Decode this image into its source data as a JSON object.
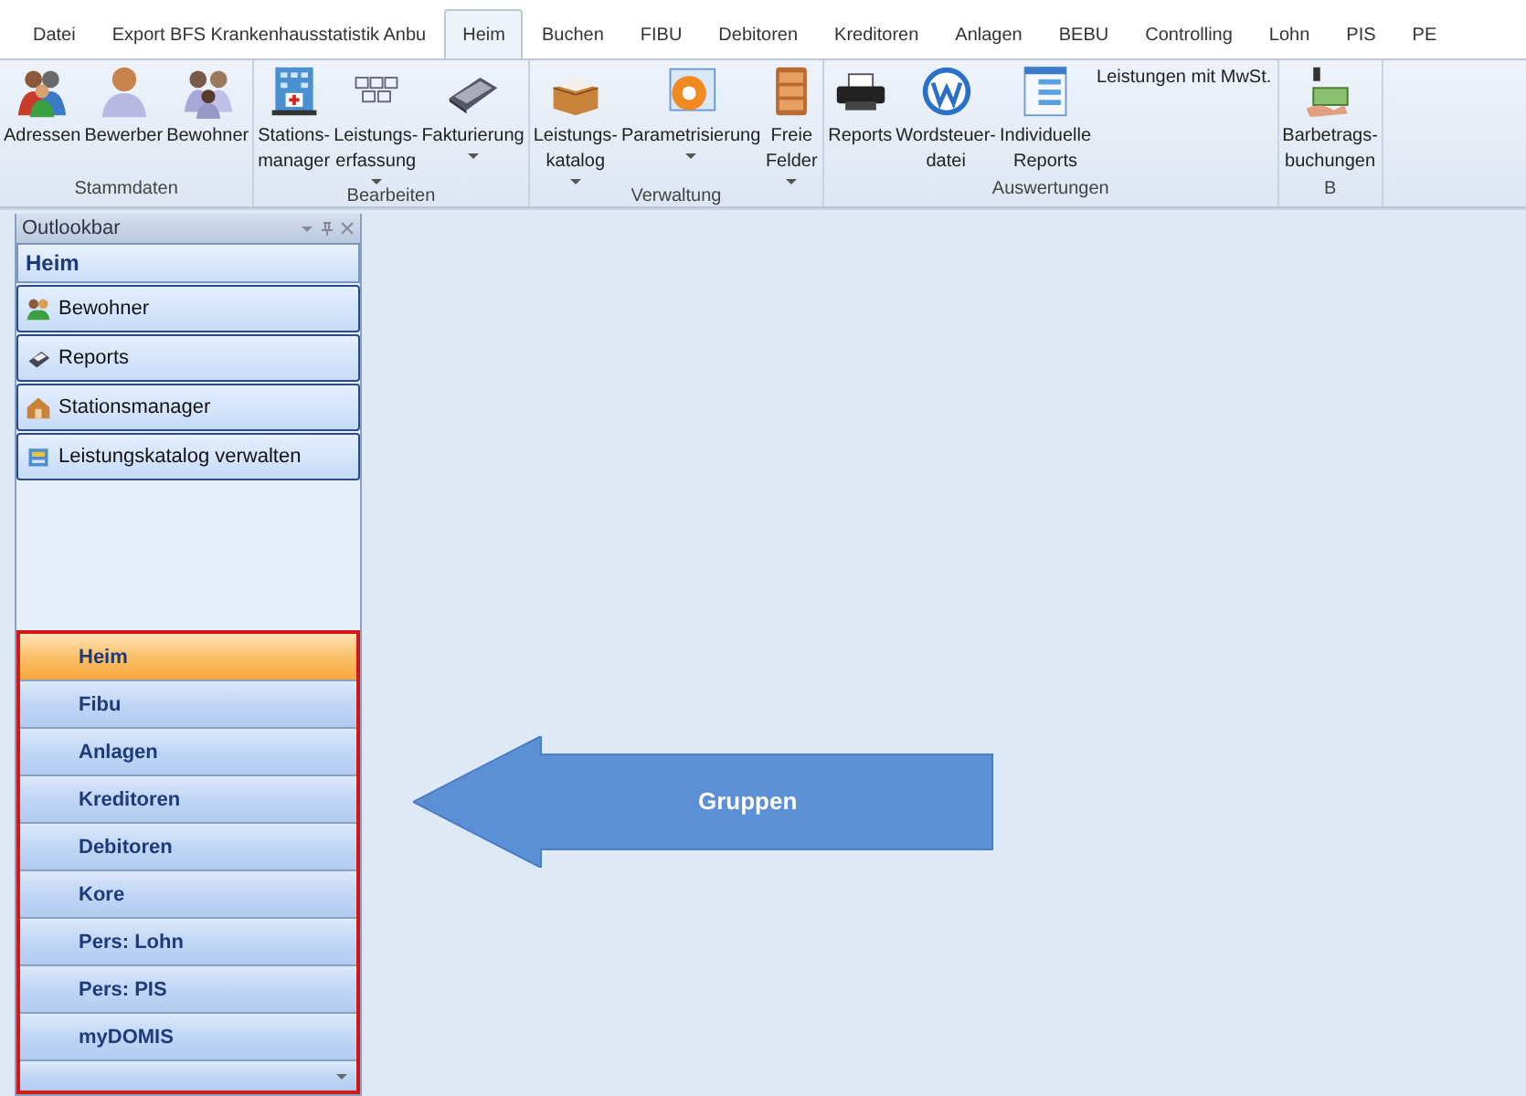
{
  "tabs": [
    {
      "label": "Datei",
      "selected": false
    },
    {
      "label": "Export BFS Krankenhausstatistik Anbu",
      "selected": false
    },
    {
      "label": "Heim",
      "selected": true
    },
    {
      "label": "Buchen",
      "selected": false
    },
    {
      "label": "FIBU",
      "selected": false
    },
    {
      "label": "Debitoren",
      "selected": false
    },
    {
      "label": "Kreditoren",
      "selected": false
    },
    {
      "label": "Anlagen",
      "selected": false
    },
    {
      "label": "BEBU",
      "selected": false
    },
    {
      "label": "Controlling",
      "selected": false
    },
    {
      "label": "Lohn",
      "selected": false
    },
    {
      "label": "PIS",
      "selected": false
    },
    {
      "label": "PE",
      "selected": false
    }
  ],
  "ribbon_groups": [
    {
      "label": "Stammdaten",
      "buttons": [
        {
          "label": "Adressen",
          "has_menu": false
        },
        {
          "label": "Bewerber",
          "has_menu": false
        },
        {
          "label": "Bewohner",
          "has_menu": false
        }
      ]
    },
    {
      "label": "Bearbeiten",
      "buttons": [
        {
          "label": "Stations-\nmanager",
          "has_menu": false
        },
        {
          "label": "Leistungs-\nerfassung",
          "has_menu": true
        },
        {
          "label": "Fakturierung",
          "has_menu": true
        }
      ]
    },
    {
      "label": "Verwaltung",
      "buttons": [
        {
          "label": "Leistungs-\nkatalog",
          "has_menu": true
        },
        {
          "label": "Parametrisierung",
          "has_menu": true
        },
        {
          "label": "Freie\nFelder",
          "has_menu": true
        }
      ]
    },
    {
      "label": "Auswertungen",
      "buttons": [
        {
          "label": "Reports",
          "has_menu": false
        },
        {
          "label": "Wordsteuer-\ndatei",
          "has_menu": false
        },
        {
          "label": "Individuelle\nReports",
          "has_menu": false
        }
      ],
      "small_button": "Leistungen mit MwSt."
    },
    {
      "label": "B",
      "buttons": [
        {
          "label": "Barbetrags-\nbuchungen",
          "has_menu": false
        }
      ]
    }
  ],
  "outlookbar": {
    "title": "Outlookbar",
    "group_title": "Heim",
    "items": [
      {
        "label": "Bewohner"
      },
      {
        "label": "Reports"
      },
      {
        "label": "Stationsmanager"
      },
      {
        "label": "Leistungskatalog verwalten"
      }
    ],
    "groups": [
      {
        "label": "Heim",
        "selected": true
      },
      {
        "label": "Fibu",
        "selected": false
      },
      {
        "label": "Anlagen",
        "selected": false
      },
      {
        "label": "Kreditoren",
        "selected": false
      },
      {
        "label": "Debitoren",
        "selected": false
      },
      {
        "label": "Kore",
        "selected": false
      },
      {
        "label": "Pers: Lohn",
        "selected": false
      },
      {
        "label": "Pers: PIS",
        "selected": false
      },
      {
        "label": "myDOMIS",
        "selected": false
      }
    ]
  },
  "annotation": {
    "label": "Gruppen"
  }
}
